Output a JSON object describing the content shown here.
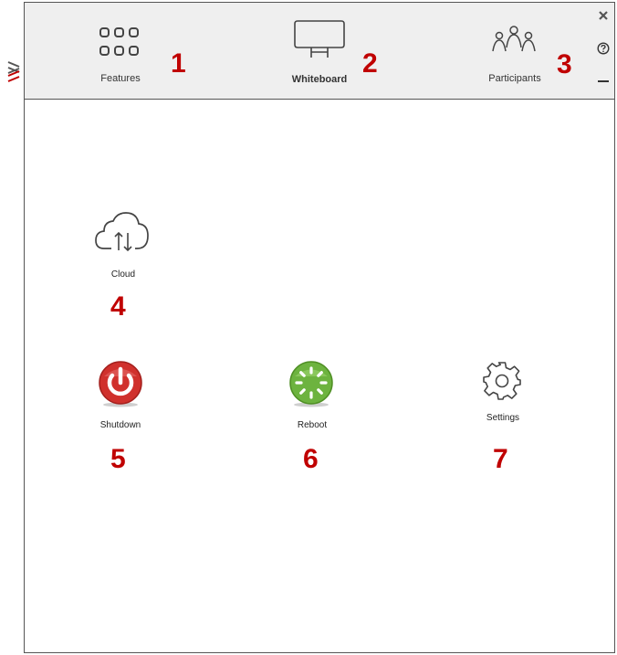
{
  "topbar": {
    "features_label": "Features",
    "whiteboard_label": "Whiteboard",
    "participants_label": "Participants"
  },
  "tiles": {
    "cloud_label": "Cloud",
    "shutdown_label": "Shutdown",
    "reboot_label": "Reboot",
    "settings_label": "Settings"
  },
  "callouts": [
    "1",
    "2",
    "3",
    "4",
    "5",
    "6",
    "7"
  ],
  "window_controls": {
    "close": "close-icon",
    "help": "help-icon",
    "minimize": "minimize-icon"
  },
  "colors": {
    "callout": "#c00000",
    "shutdown": "#d0312d",
    "reboot": "#6db33f",
    "topbar_bg": "#efefef"
  }
}
